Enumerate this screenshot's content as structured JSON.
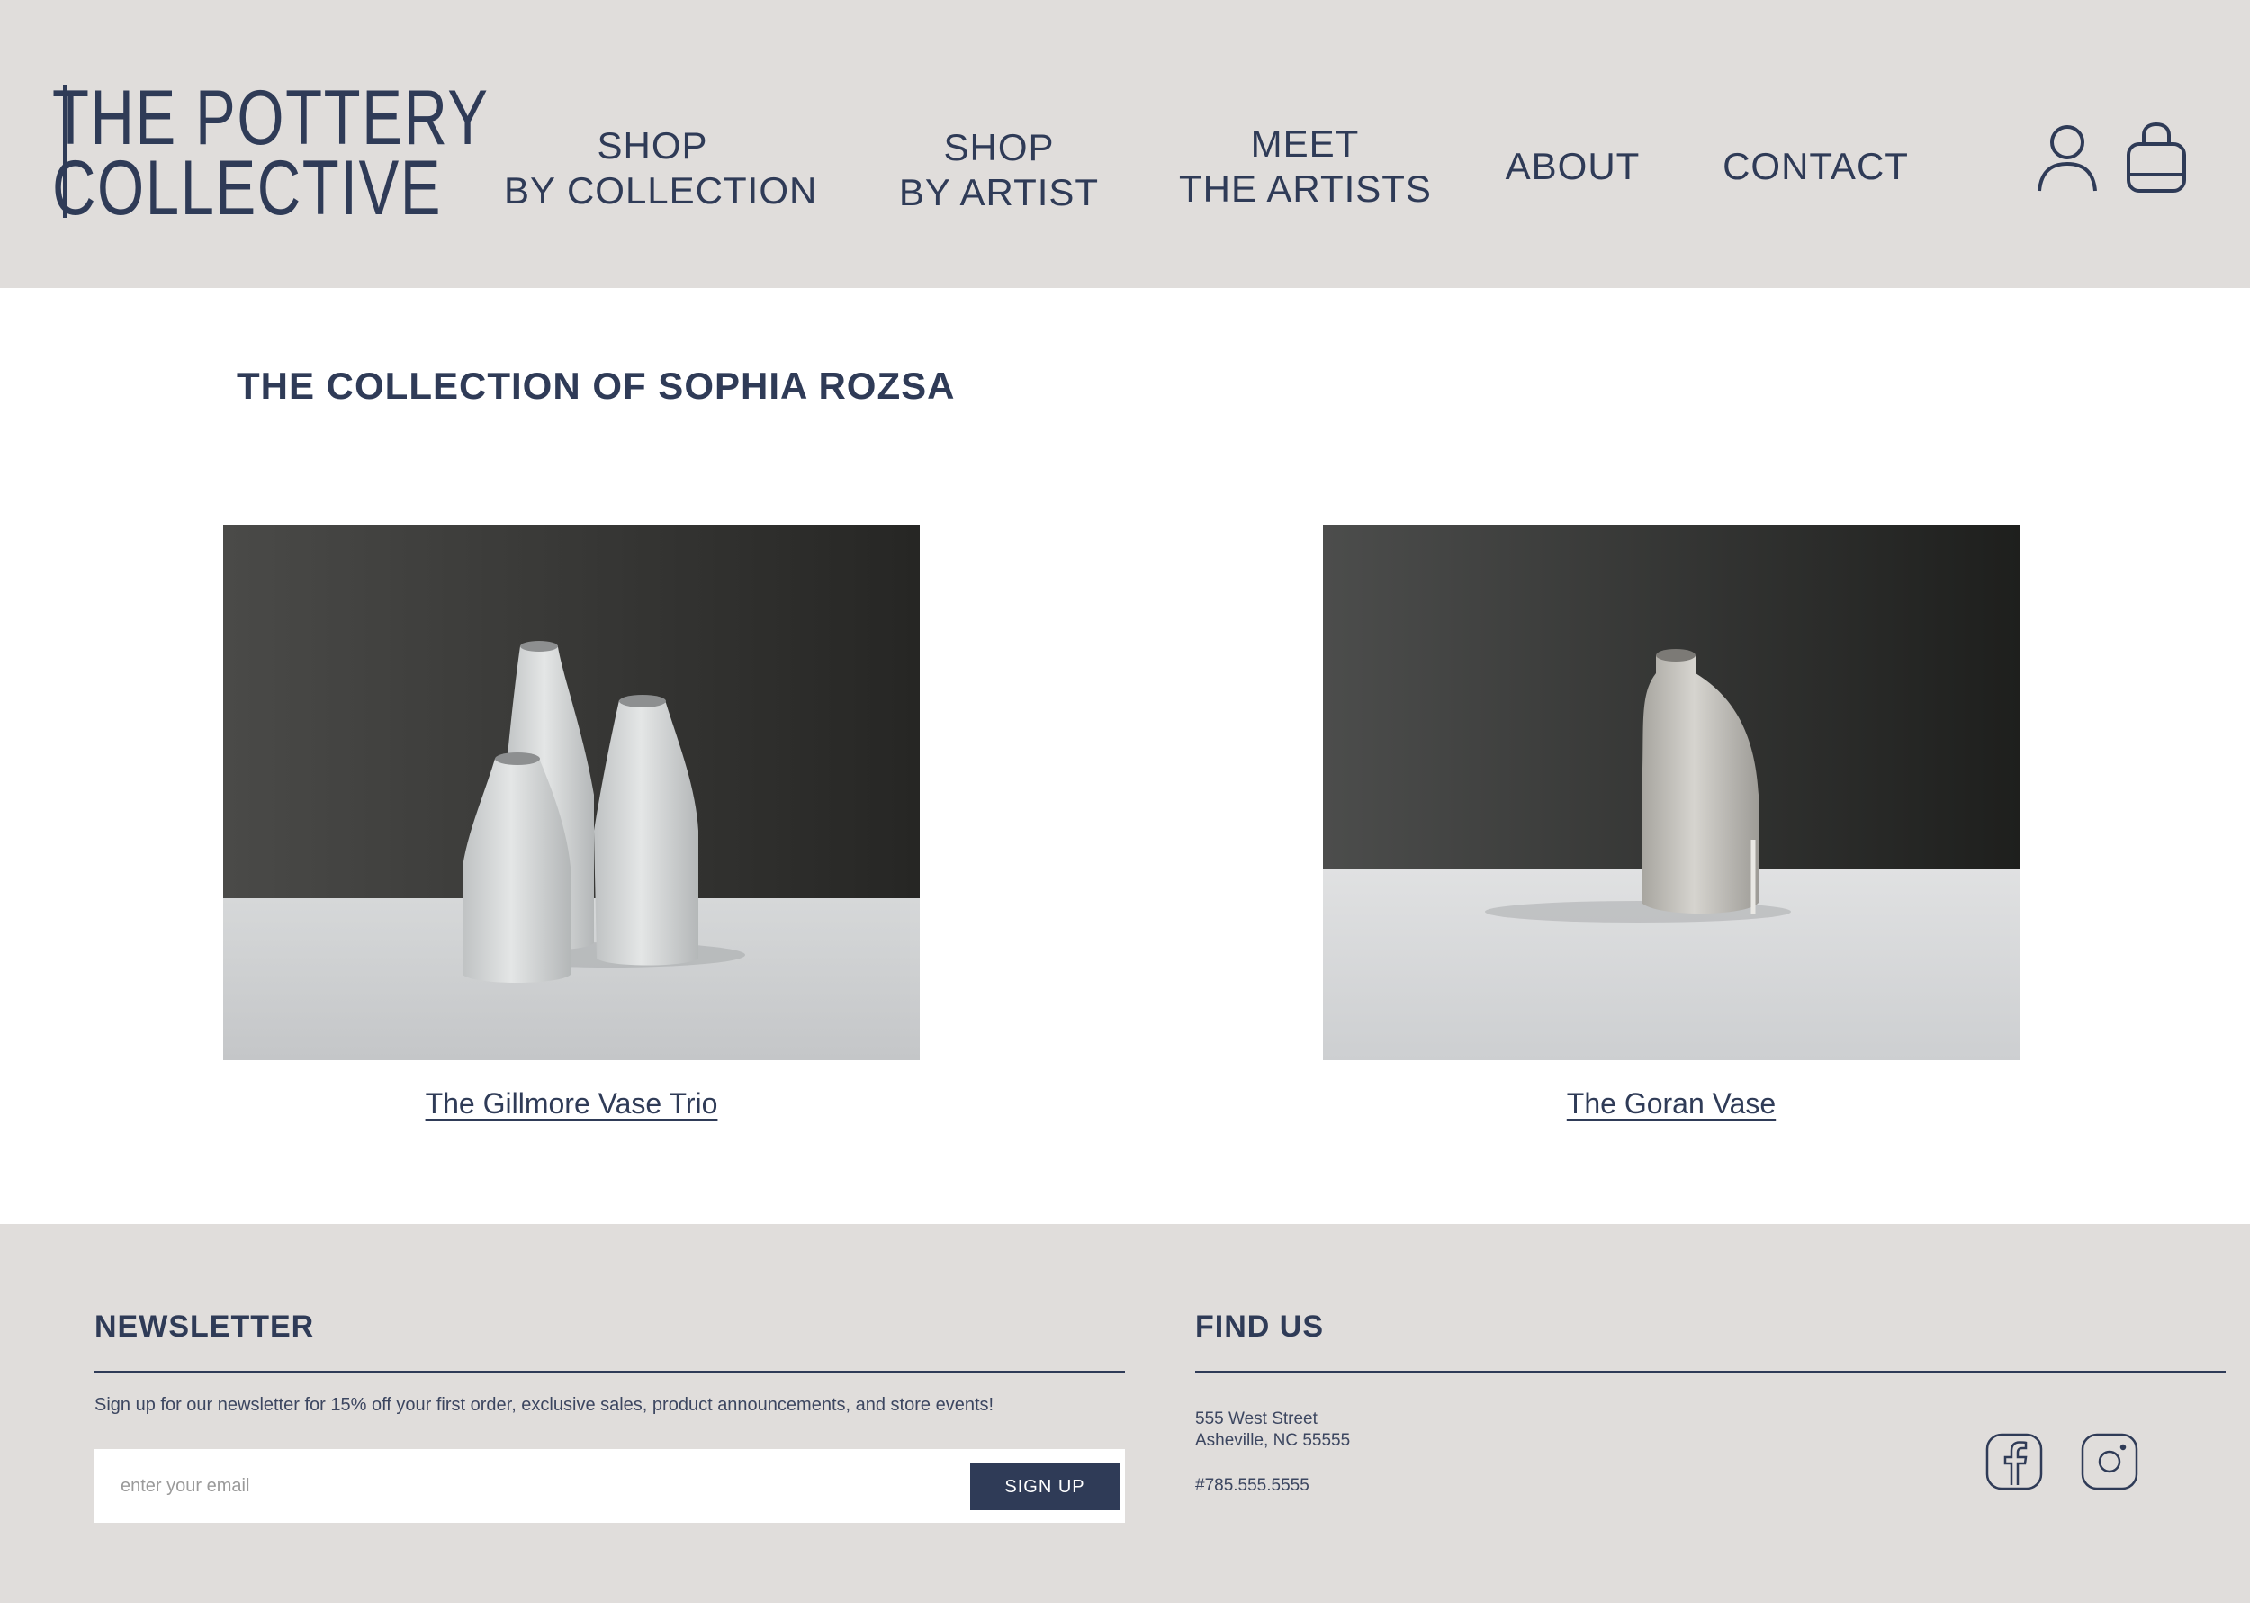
{
  "brand": {
    "line1": "THE POTTERY",
    "line2": "COLLECTIVE"
  },
  "nav": {
    "shop_collection": [
      "SHOP",
      "BY COLLECTION"
    ],
    "shop_artist": [
      "SHOP",
      "BY ARTIST"
    ],
    "meet_artists": [
      "MEET",
      "THE ARTISTS"
    ],
    "about": "ABOUT",
    "contact": "CONTACT"
  },
  "icons": {
    "account": "account-icon",
    "bag": "shopping-bag-icon",
    "facebook": "facebook-icon",
    "instagram": "instagram-icon"
  },
  "main": {
    "title": "THE COLLECTION OF SOPHIA ROZSA",
    "products": [
      {
        "name": "The Gillmore Vase Trio"
      },
      {
        "name": "The Goran Vase"
      }
    ]
  },
  "footer": {
    "newsletter": {
      "heading": "NEWSLETTER",
      "text": "Sign up for our newsletter for 15% off your first order, exclusive sales, product announcements, and store events!",
      "placeholder": "enter your email",
      "button": "SIGN UP"
    },
    "find_us": {
      "heading": "FIND US",
      "street": "555 West Street",
      "city": "Asheville, NC 55555",
      "phone": "#785.555.5555"
    }
  },
  "colors": {
    "accent": "#2f3b57",
    "header_bg": "#e0dddb",
    "page_bg": "#ffffff"
  }
}
